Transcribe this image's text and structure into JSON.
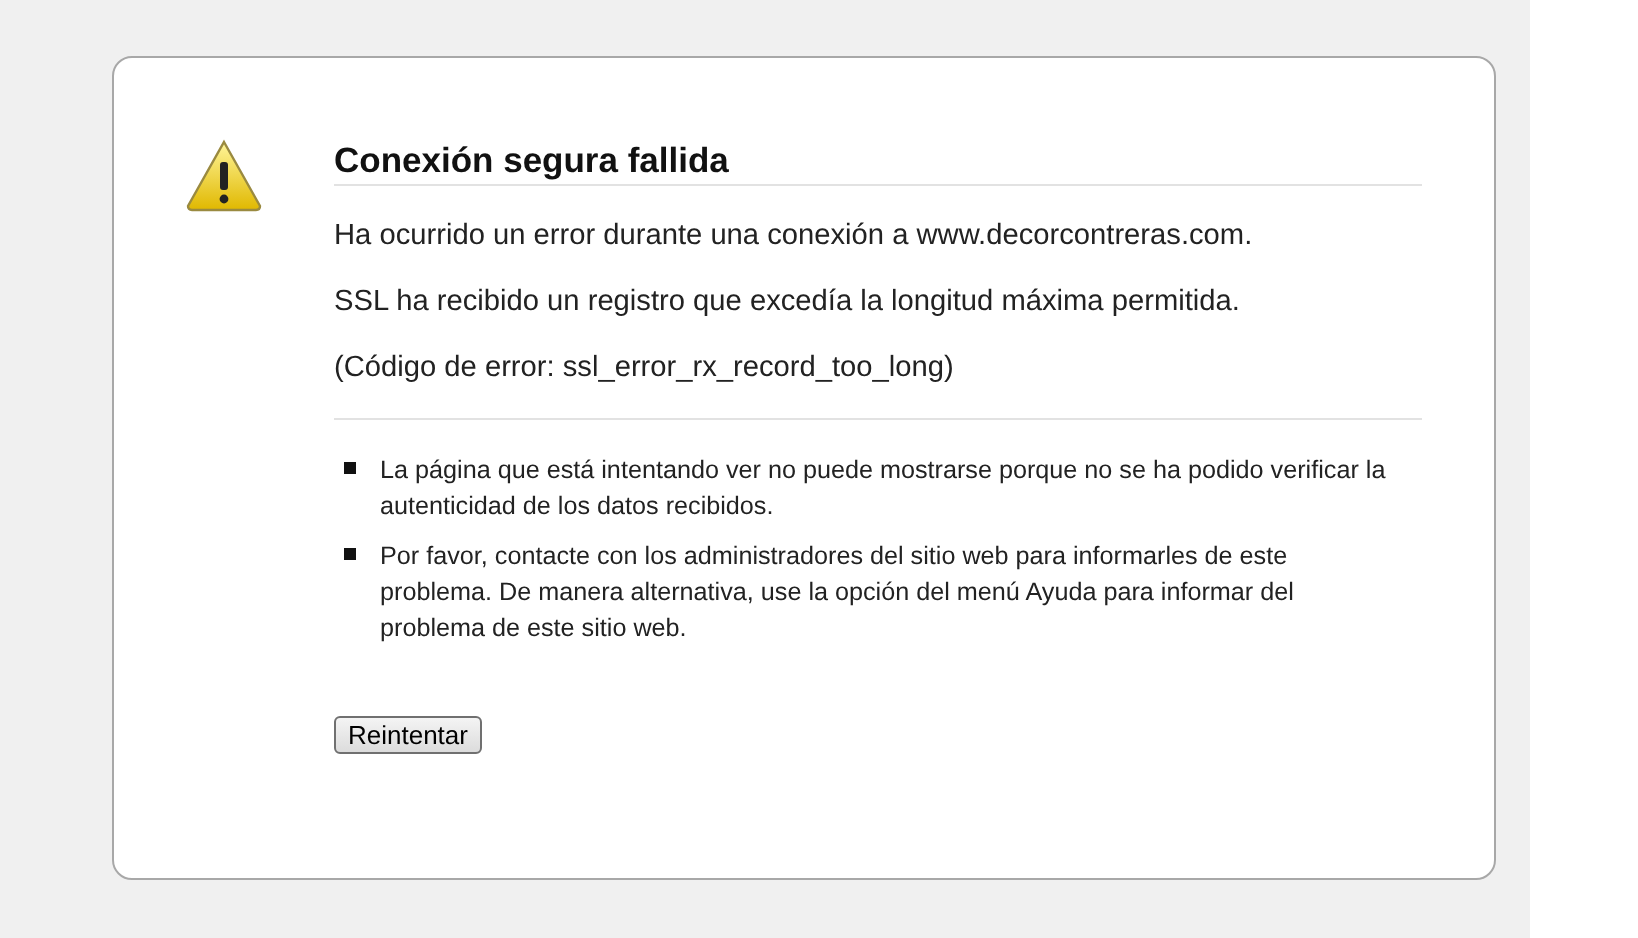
{
  "title": "Conexión segura fallida",
  "paragraphs": [
    "Ha ocurrido un error durante una conexión a www.decorcontreras.com.",
    "SSL ha recibido un registro que excedía la longitud máxima permitida.",
    "(Código de error: ssl_error_rx_record_too_long)"
  ],
  "bullets": [
    "La página que está intentando ver no puede mostrarse porque no se ha podido verificar la autenticidad de los datos recibidos.",
    "Por favor, contacte con los administradores del sitio web para informarles de este problema. De manera alternativa, use la opción del menú Ayuda para informar del problema de este sitio web."
  ],
  "button": "Reintentar"
}
